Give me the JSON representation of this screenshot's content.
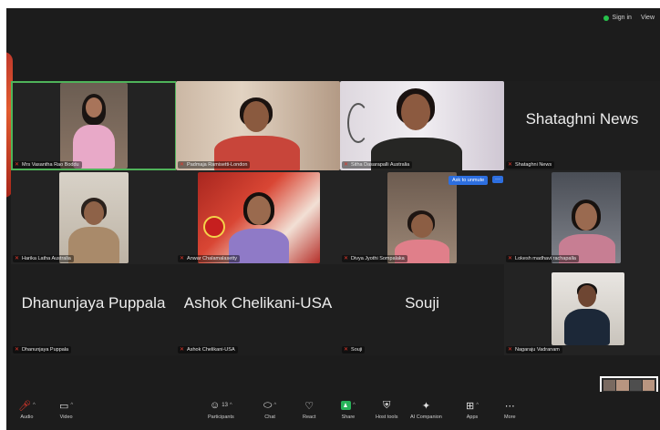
{
  "app": {
    "signin_label": "Sign in",
    "view_label": "View"
  },
  "participants": [
    {
      "name": "Mrs Vasantha Rao Boddu",
      "type": "video",
      "active": true
    },
    {
      "name": "Padmaja Ramisetti-London",
      "type": "video"
    },
    {
      "name": "Sitha Dasarapalli Australia",
      "type": "video"
    },
    {
      "name": "Shataghni News",
      "type": "name"
    },
    {
      "name": "Harika Latha Australia",
      "type": "video"
    },
    {
      "name": "Anwar Chalamalasetty",
      "type": "video"
    },
    {
      "name": "Divya Jyothi Sompalaka",
      "type": "video",
      "ask_to_unmute": "Ask to unmute",
      "more": "···"
    },
    {
      "name": "Lokesh madhavi rachapalla",
      "type": "video"
    },
    {
      "name": "Dhanunjaya Puppala",
      "type": "name"
    },
    {
      "name": "Ashok Chelikani-USA",
      "type": "name"
    },
    {
      "name": "Souji",
      "type": "name"
    },
    {
      "name": "Nagaraju Vadranam",
      "type": "video"
    }
  ],
  "toolbar": {
    "audio": "Audio",
    "video": "Video",
    "participants": "Participants",
    "participants_count": "13",
    "chat": "Chat",
    "react": "React",
    "share": "Share",
    "host_tools": "Host tools",
    "ai_companion": "AI Companion",
    "apps": "Apps",
    "more": "More"
  },
  "colors": {
    "background": "#1c1c1c",
    "tile": "#232323",
    "active_speaker": "#4fb35a",
    "muted": "#e2372b",
    "accent_blue": "#2d6fe0",
    "share_green": "#27b35a"
  }
}
